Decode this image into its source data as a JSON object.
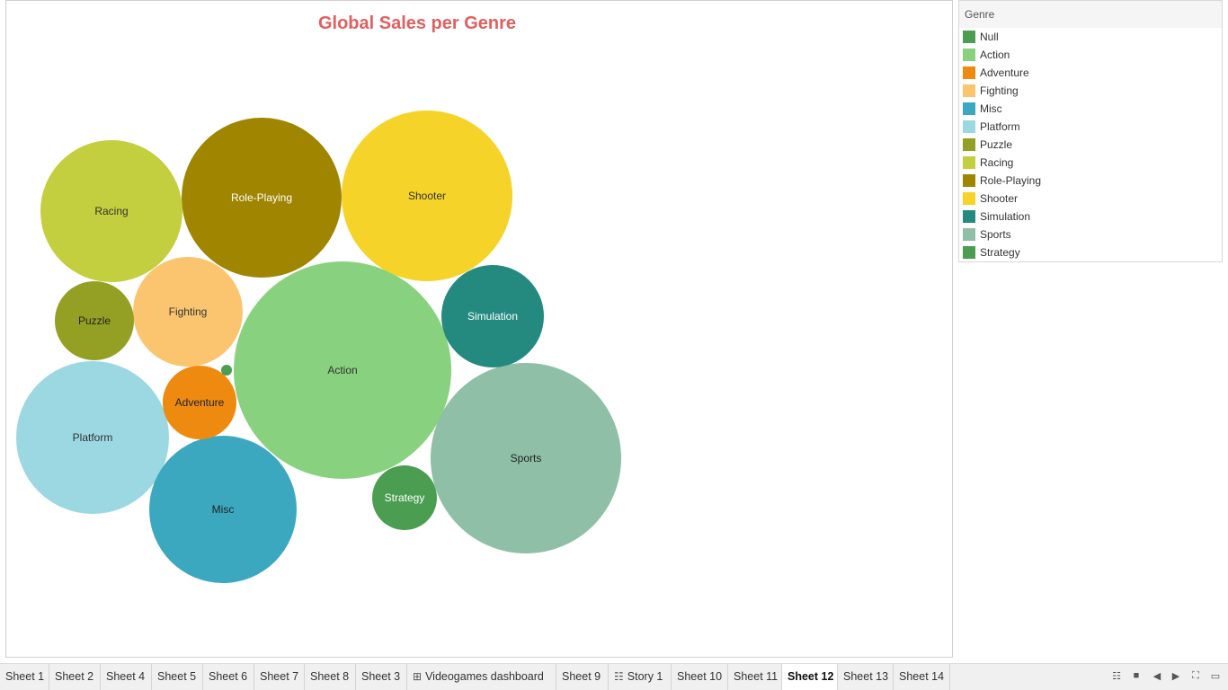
{
  "chart_data": {
    "type": "bubble",
    "title": "Global Sales per Genre",
    "bubbles": [
      {
        "label": "Action",
        "color": "#88d17e",
        "text": "#333333",
        "value": 1.0
      },
      {
        "label": "Sports",
        "color": "#8fbfa6",
        "text": "#222222",
        "value": 0.76
      },
      {
        "label": "Shooter",
        "color": "#f5d328",
        "text": "#333333",
        "value": 0.62
      },
      {
        "label": "Role-Playing",
        "color": "#a08500",
        "text": "#ffffff",
        "value": 0.53
      },
      {
        "label": "Platform",
        "color": "#9bd8e2",
        "text": "#333333",
        "value": 0.49
      },
      {
        "label": "Misc",
        "color": "#3ca8bf",
        "text": "#222222",
        "value": 0.45
      },
      {
        "label": "Racing",
        "color": "#c3cf3e",
        "text": "#333333",
        "value": 0.42
      },
      {
        "label": "Fighting",
        "color": "#fbc56f",
        "text": "#333333",
        "value": 0.25
      },
      {
        "label": "Simulation",
        "color": "#248a80",
        "text": "#ffffff",
        "value": 0.22
      },
      {
        "label": "Puzzle",
        "color": "#93a024",
        "text": "#222222",
        "value": 0.13
      },
      {
        "label": "Adventure",
        "color": "#ef8a10",
        "text": "#222222",
        "value": 0.11
      },
      {
        "label": "Strategy",
        "color": "#4b9d51",
        "text": "#ffffff",
        "value": 0.09
      },
      {
        "label": "Null",
        "color": "#4b9d51",
        "text": "#ffffff",
        "value": 0.002
      }
    ]
  },
  "legend": {
    "title": "Genre",
    "items": [
      {
        "label": "Null",
        "color": "#4b9d51"
      },
      {
        "label": "Action",
        "color": "#88d17e"
      },
      {
        "label": "Adventure",
        "color": "#ef8a10"
      },
      {
        "label": "Fighting",
        "color": "#fbc56f"
      },
      {
        "label": "Misc",
        "color": "#3ca8bf"
      },
      {
        "label": "Platform",
        "color": "#9bd8e2"
      },
      {
        "label": "Puzzle",
        "color": "#93a024"
      },
      {
        "label": "Racing",
        "color": "#c3cf3e"
      },
      {
        "label": "Role-Playing",
        "color": "#a08500"
      },
      {
        "label": "Shooter",
        "color": "#f5d328"
      },
      {
        "label": "Simulation",
        "color": "#248a80"
      },
      {
        "label": "Sports",
        "color": "#8fbfa6"
      },
      {
        "label": "Strategy",
        "color": "#4b9d51"
      }
    ]
  },
  "tabs": [
    {
      "label": "Sheet 1"
    },
    {
      "label": "Sheet 2"
    },
    {
      "label": "Sheet 4"
    },
    {
      "label": "Sheet 5"
    },
    {
      "label": "Sheet 6"
    },
    {
      "label": "Sheet 7"
    },
    {
      "label": "Sheet 8"
    },
    {
      "label": "Sheet 3"
    },
    {
      "label": "Videogames dashboard",
      "icon": "dashboard-icon"
    },
    {
      "label": "Sheet 9"
    },
    {
      "label": "Story 1",
      "icon": "story-icon"
    },
    {
      "label": "Sheet 10"
    },
    {
      "label": "Sheet 11"
    },
    {
      "label": "Sheet 12",
      "active": true
    },
    {
      "label": "Sheet 13"
    },
    {
      "label": "Sheet 14"
    }
  ],
  "nav_controls": [
    "filmstrip-icon",
    "sheet-view-icon",
    "prev-icon",
    "next-icon",
    "fit-screen-icon",
    "present-icon"
  ]
}
